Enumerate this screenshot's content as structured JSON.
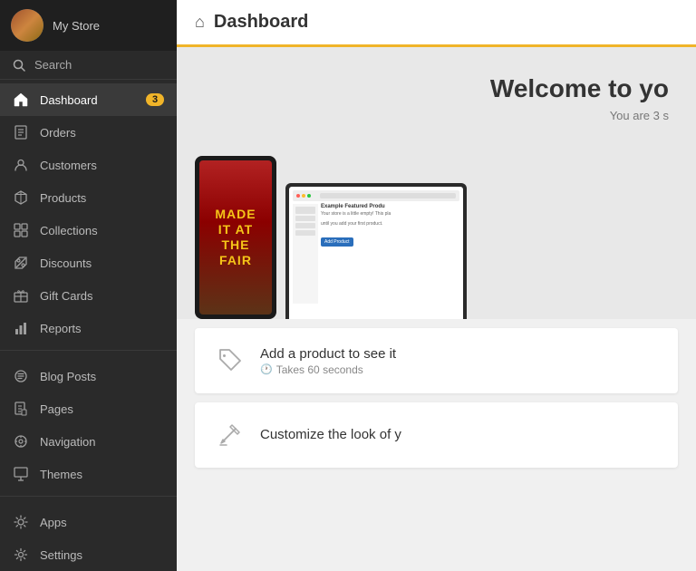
{
  "sidebar": {
    "store_name": "My Store",
    "search_placeholder": "Search",
    "items": [
      {
        "id": "dashboard",
        "label": "Dashboard",
        "active": true,
        "badge": "3"
      },
      {
        "id": "orders",
        "label": "Orders",
        "active": false
      },
      {
        "id": "customers",
        "label": "Customers",
        "active": false
      },
      {
        "id": "products",
        "label": "Products",
        "active": false
      },
      {
        "id": "collections",
        "label": "Collections",
        "active": false
      },
      {
        "id": "discounts",
        "label": "Discounts",
        "active": false
      },
      {
        "id": "gift-cards",
        "label": "Gift Cards",
        "active": false
      },
      {
        "id": "reports",
        "label": "Reports",
        "active": false
      },
      {
        "id": "blog-posts",
        "label": "Blog Posts",
        "active": false
      },
      {
        "id": "pages",
        "label": "Pages",
        "active": false
      },
      {
        "id": "navigation",
        "label": "Navigation",
        "active": false
      },
      {
        "id": "themes",
        "label": "Themes",
        "active": false
      },
      {
        "id": "apps",
        "label": "Apps",
        "active": false
      },
      {
        "id": "settings",
        "label": "Settings",
        "active": false
      }
    ]
  },
  "topbar": {
    "title": "Dashboard"
  },
  "main": {
    "welcome_title": "Welcome to yo",
    "welcome_subtitle": "You are 3 s",
    "phone_text": "FAIR",
    "laptop_product_label": "Example Featured Produ",
    "laptop_product_desc": "Your store is a little empty! This pla",
    "laptop_product_desc2": "until you add your first product.",
    "laptop_btn": "Add Product"
  },
  "cards": [
    {
      "id": "add-product",
      "title": "Add a product to see it",
      "subtitle": "Takes 60 seconds",
      "icon": "tag"
    },
    {
      "id": "customize-look",
      "title": "Customize the look of y",
      "subtitle": "",
      "icon": "wrench"
    }
  ]
}
